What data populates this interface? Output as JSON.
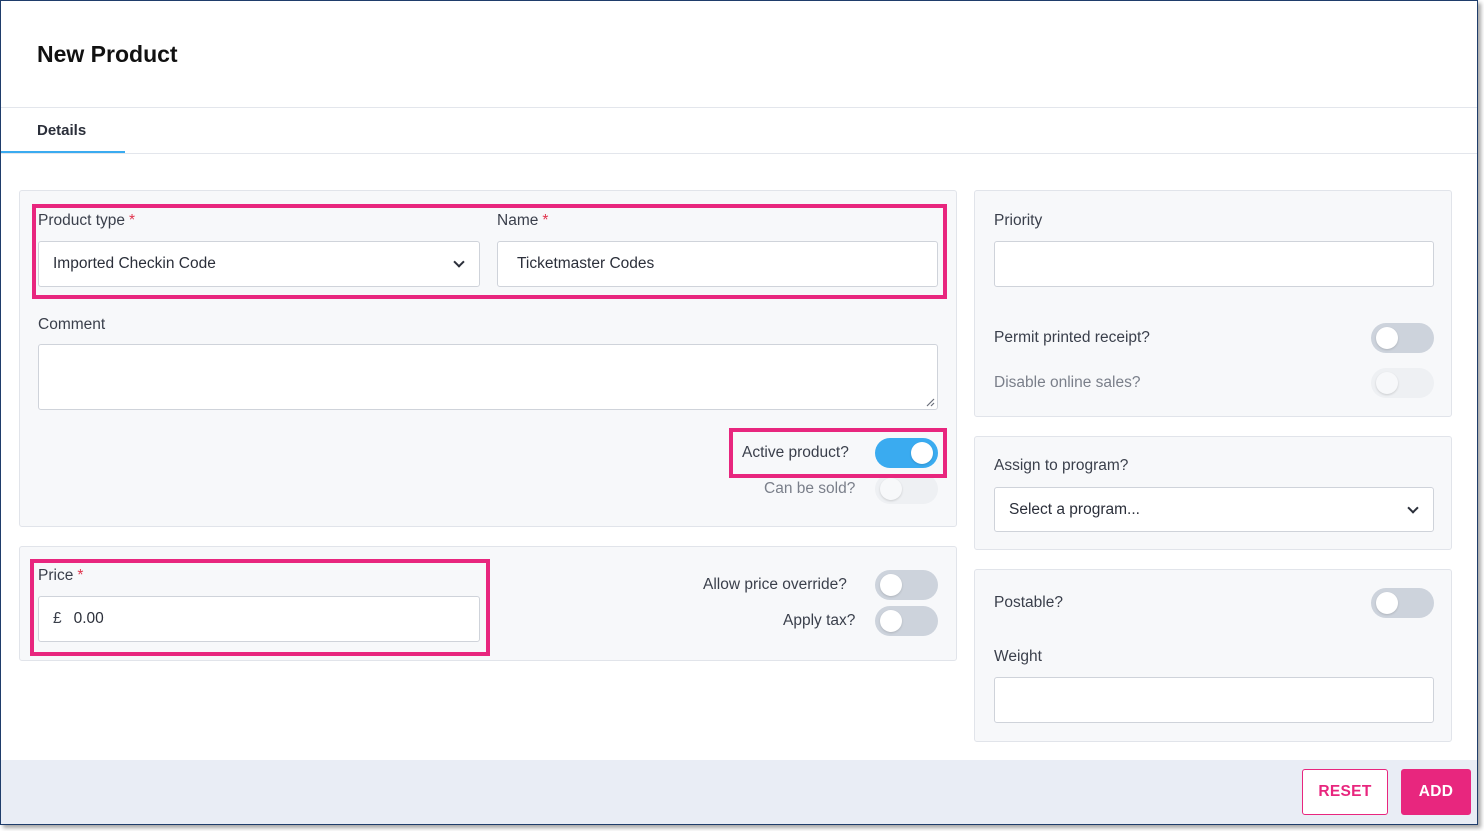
{
  "page": {
    "title": "New Product"
  },
  "tabs": [
    {
      "label": "Details",
      "active": true
    }
  ],
  "product_type": {
    "label": "Product type",
    "required_mark": "*",
    "value": "Imported Checkin Code"
  },
  "name": {
    "label": "Name",
    "required_mark": "*",
    "value": "Ticketmaster Codes"
  },
  "comment": {
    "label": "Comment",
    "value": ""
  },
  "active_product": {
    "label": "Active product?",
    "on": true
  },
  "can_be_sold": {
    "label": "Can be sold?",
    "on": false,
    "disabled": true
  },
  "price": {
    "label": "Price",
    "required_mark": "*",
    "currency": "£",
    "value": "0.00"
  },
  "allow_price_override": {
    "label": "Allow price override?",
    "on": false
  },
  "apply_tax": {
    "label": "Apply tax?",
    "on": false
  },
  "priority": {
    "label": "Priority",
    "value": ""
  },
  "permit_printed_receipt": {
    "label": "Permit printed receipt?",
    "on": false
  },
  "disable_online_sales": {
    "label": "Disable online sales?",
    "on": false,
    "disabled": true
  },
  "assign_program": {
    "label": "Assign to program?",
    "value": "Select a program..."
  },
  "postable": {
    "label": "Postable?",
    "on": false
  },
  "weight": {
    "label": "Weight",
    "value": ""
  },
  "footer": {
    "reset_label": "RESET",
    "add_label": "ADD"
  },
  "colors": {
    "accent": "#3aabf0",
    "highlight": "#e8267e",
    "toggle_off": "#cdd3dc"
  }
}
